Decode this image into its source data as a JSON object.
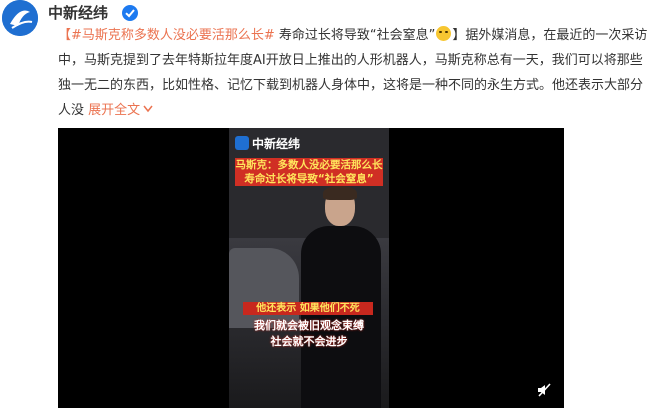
{
  "account": {
    "name": "中新经纬",
    "avatar_icon": "cnfinance-logo-icon",
    "verified_icon": "verified-check-icon"
  },
  "post": {
    "hashtag": "【#马斯克称多数人没必要活那么长#",
    "text_part1": " 寿命过长将导致“社会窒息”",
    "emoji": "grimace-emoji-icon",
    "text_part2": "】据外媒消息，在最近的一次采访中，马斯克提到了去年特斯拉年度AI开放日上推出的人形机器人，马斯克称总有一天，我们可以将那些独一无二的东西，比如性格、记忆下载到机器人身体中，这将是一种不同的永生方式。他还表示大部分人没",
    "expand_label": "展开全文",
    "expand_icon": "chevron-down-icon"
  },
  "video": {
    "logo_text": "中新经纬",
    "logo_sub": "中新经纬",
    "caption_line1": "马斯克：多数人没必要活那么长",
    "caption_line2": "寿命过长将导致“社会窒息”",
    "subtitle1": "他还表示 如果他们不死",
    "subtitle2": "我们就会被旧观念束缚",
    "subtitle3": "社会就不会进步",
    "mute_icon": "mute-icon"
  },
  "colors": {
    "link": "#eb7350",
    "caption_bg": "#d02f24",
    "caption_text": "#ffe45c"
  }
}
